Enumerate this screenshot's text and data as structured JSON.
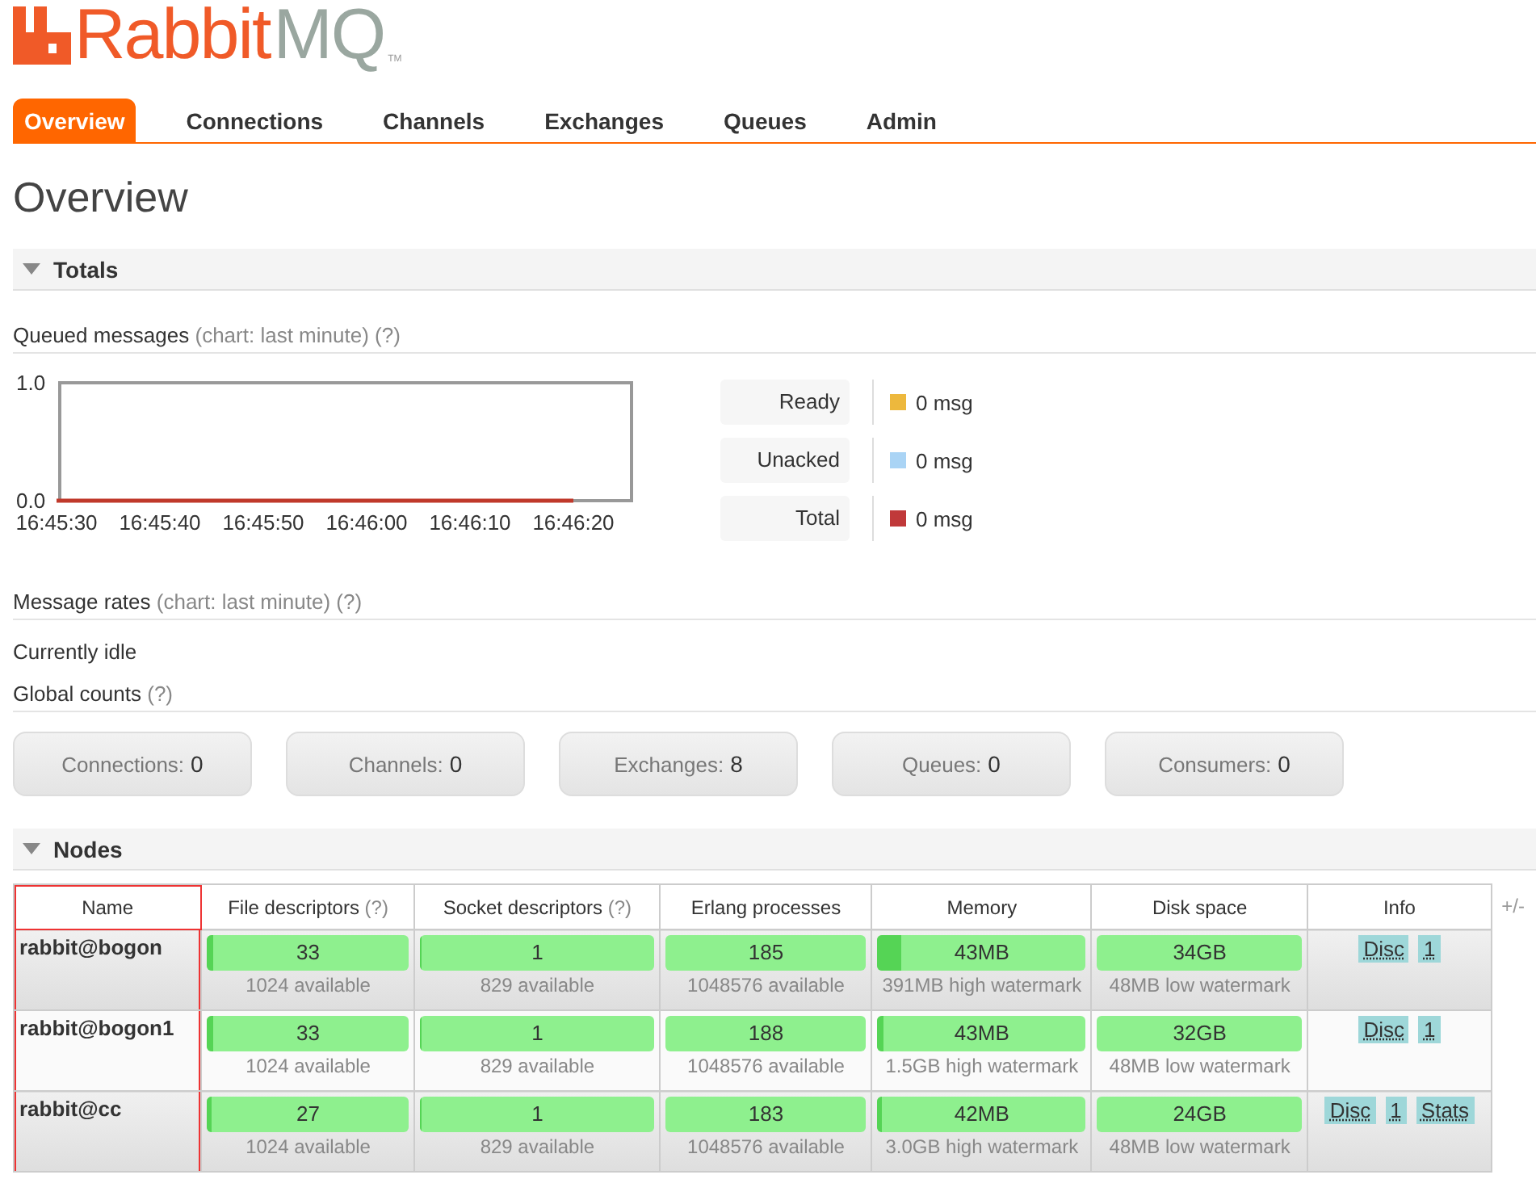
{
  "logo": {
    "rabbit": "Rabbit",
    "mq": "MQ",
    "tm": "TM"
  },
  "tabs": [
    {
      "label": "Overview",
      "selected": true
    },
    {
      "label": "Connections",
      "selected": false
    },
    {
      "label": "Channels",
      "selected": false
    },
    {
      "label": "Exchanges",
      "selected": false
    },
    {
      "label": "Queues",
      "selected": false
    },
    {
      "label": "Admin",
      "selected": false
    }
  ],
  "title": "Overview",
  "totals": {
    "heading": "Totals",
    "expanded": true,
    "queued": {
      "label": "Queued messages",
      "hint": "(chart: last minute)",
      "help": "(?)",
      "chart_data": {
        "type": "line",
        "categories": [
          "16:45:30",
          "16:45:40",
          "16:45:50",
          "16:46:00",
          "16:46:10",
          "16:46:20"
        ],
        "ylim": [
          0,
          1
        ],
        "yticks": [
          {
            "value": 0,
            "label": "0.0"
          },
          {
            "value": 1,
            "label": "1.0"
          }
        ],
        "series": [
          {
            "color": "#c0392b",
            "values": [
              0,
              0,
              0,
              0,
              0,
              0
            ]
          }
        ]
      },
      "legend": [
        {
          "label": "Ready",
          "color": "#edb83d",
          "value": "0 msg"
        },
        {
          "label": "Unacked",
          "color": "#aad4f5",
          "value": "0 msg"
        },
        {
          "label": "Total",
          "color": "#c0393a",
          "value": "0 msg"
        }
      ]
    },
    "rates": {
      "label": "Message rates",
      "hint": "(chart: last minute)",
      "help": "(?)",
      "status": "Currently idle"
    },
    "global": {
      "label": "Global counts",
      "help": "(?)",
      "counts": [
        {
          "label": "Connections:",
          "value": "0"
        },
        {
          "label": "Channels:",
          "value": "0"
        },
        {
          "label": "Exchanges:",
          "value": "8"
        },
        {
          "label": "Queues:",
          "value": "0"
        },
        {
          "label": "Consumers:",
          "value": "0"
        }
      ]
    }
  },
  "nodes": {
    "heading": "Nodes",
    "expanded": true,
    "toggle": "+/-",
    "name_column_highlighted": true,
    "columns": [
      {
        "label": "Name"
      },
      {
        "label": "File descriptors",
        "help": "(?)"
      },
      {
        "label": "Socket descriptors",
        "help": "(?)"
      },
      {
        "label": "Erlang processes"
      },
      {
        "label": "Memory"
      },
      {
        "label": "Disk space"
      },
      {
        "label": "Info"
      }
    ],
    "rows": [
      {
        "name": "rabbit@bogon",
        "fd": {
          "value": "33",
          "sub": "1024 available",
          "level": 0.03
        },
        "sockets": {
          "value": "1",
          "sub": "829 available",
          "level": 0.001
        },
        "processes": {
          "value": "185",
          "sub": "1048576 available",
          "level": 0.0002
        },
        "memory": {
          "value": "43MB",
          "sub": "391MB high watermark",
          "level": 0.11
        },
        "disk": {
          "value": "34GB",
          "sub": "48MB low watermark"
        },
        "info": [
          "Disc",
          "1"
        ]
      },
      {
        "name": "rabbit@bogon1",
        "fd": {
          "value": "33",
          "sub": "1024 available",
          "level": 0.03
        },
        "sockets": {
          "value": "1",
          "sub": "829 available",
          "level": 0.001
        },
        "processes": {
          "value": "188",
          "sub": "1048576 available",
          "level": 0.0002
        },
        "memory": {
          "value": "43MB",
          "sub": "1.5GB high watermark",
          "level": 0.03
        },
        "disk": {
          "value": "32GB",
          "sub": "48MB low watermark"
        },
        "info": [
          "Disc",
          "1"
        ]
      },
      {
        "name": "rabbit@cc",
        "fd": {
          "value": "27",
          "sub": "1024 available",
          "level": 0.026
        },
        "sockets": {
          "value": "1",
          "sub": "829 available",
          "level": 0.001
        },
        "processes": {
          "value": "183",
          "sub": "1048576 available",
          "level": 0.0002
        },
        "memory": {
          "value": "42MB",
          "sub": "3.0GB high watermark",
          "level": 0.014
        },
        "disk": {
          "value": "24GB",
          "sub": "48MB low watermark"
        },
        "info": [
          "Disc",
          "1",
          "Stats"
        ]
      }
    ]
  }
}
